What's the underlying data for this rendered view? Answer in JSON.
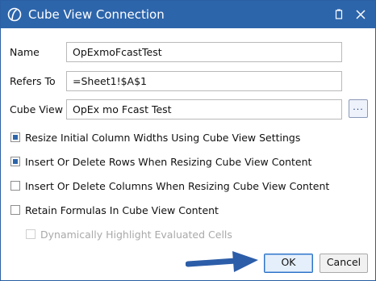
{
  "window": {
    "title": "Cube View Connection",
    "accent_color": "#2d65ab"
  },
  "form": {
    "name_label": "Name",
    "name_value": "OpExmoFcastTest",
    "refers_to_label": "Refers To",
    "refers_to_value": "=Sheet1!$A$1",
    "cube_view_label": "Cube View",
    "cube_view_value": "OpEx mo Fcast Test",
    "browse_label": "..."
  },
  "options": [
    {
      "label": "Resize Initial Column Widths Using Cube View Settings",
      "checked": true,
      "enabled": true
    },
    {
      "label": "Insert Or Delete Rows When Resizing Cube View Content",
      "checked": true,
      "enabled": true
    },
    {
      "label": "Insert Or Delete Columns When Resizing Cube View Content",
      "checked": false,
      "enabled": true
    },
    {
      "label": "Retain Formulas In Cube View Content",
      "checked": false,
      "enabled": true
    },
    {
      "label": "Dynamically Highlight Evaluated Cells",
      "checked": false,
      "enabled": false
    }
  ],
  "buttons": {
    "ok_label": "OK",
    "cancel_label": "Cancel"
  },
  "icons": {
    "logo": "onestream-logo-icon",
    "restore": "restore-window-icon",
    "close": "close-icon",
    "annotation": "arrow-right-icon"
  }
}
